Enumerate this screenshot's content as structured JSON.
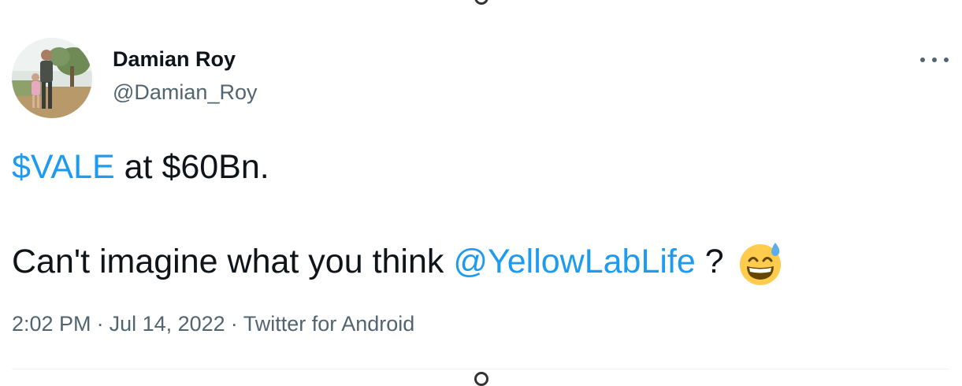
{
  "author": {
    "display_name": "Damian Roy",
    "handle": "@Damian_Roy"
  },
  "tweet": {
    "cashtag": "$VALE",
    "line1_rest": " at $60Bn.",
    "line2_prefix": "Can't imagine what you think ",
    "mention": "@YellowLabLife",
    "line2_suffix": " ? ",
    "emoji": "grinning-face-with-sweat"
  },
  "meta": {
    "time": "2:02 PM",
    "separator": "·",
    "date": "Jul 14, 2022",
    "source": "Twitter for Android"
  },
  "colors": {
    "link": "#1d9bf0",
    "secondary_text": "#536471",
    "primary_text": "#0f1419"
  },
  "icons": {
    "more": "more-horizontal-icon"
  }
}
